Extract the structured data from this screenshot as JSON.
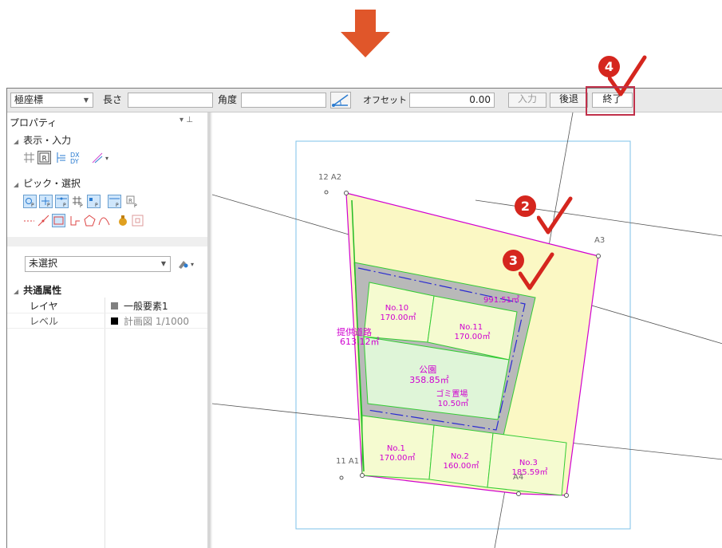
{
  "toolbar": {
    "mode_select": "極座標",
    "length_label": "長さ",
    "length_value": "",
    "angle_label": "角度",
    "angle_value": "",
    "offset_label": "オフセット",
    "offset_value": "0.00",
    "input_button": "入力",
    "back_button": "後退",
    "finish_button": "終了"
  },
  "panel": {
    "title": "プロパティ",
    "pin": "▾ ⊥",
    "section_display": "表示・入力",
    "section_pick": "ピック・選択",
    "selection_value": "未選択",
    "common_props_title": "共通属性",
    "props": [
      {
        "label": "レイヤ",
        "value": "一般要素1",
        "swatch": "#808080"
      },
      {
        "label": "レベル",
        "value": "計画図 1/1000",
        "swatch": "#000000"
      }
    ]
  },
  "drawing": {
    "labels": {
      "a2": "12  A2",
      "a1": "11  A1",
      "a3": "A3",
      "a4": "A4",
      "road": "提供道路\n613.12㎡",
      "area_total": "991.51㎡"
    },
    "lots": [
      {
        "name": "No.10",
        "area": "170.00㎡"
      },
      {
        "name": "No.11",
        "area": "170.00㎡"
      },
      {
        "name": "公園",
        "area": "358.85㎡"
      },
      {
        "name": "ゴミ置場",
        "area": "10.50㎡"
      },
      {
        "name": "No.1",
        "area": "170.00㎡"
      },
      {
        "name": "No.2",
        "area": "160.00㎡"
      },
      {
        "name": "No.3",
        "area": "185.59㎡"
      }
    ]
  },
  "callouts": [
    "2",
    "3",
    "4"
  ],
  "colors": {
    "accent": "#e0562a",
    "callout": "#d5261e",
    "boundary": "#d000d0",
    "lot_line": "#33cc33"
  }
}
